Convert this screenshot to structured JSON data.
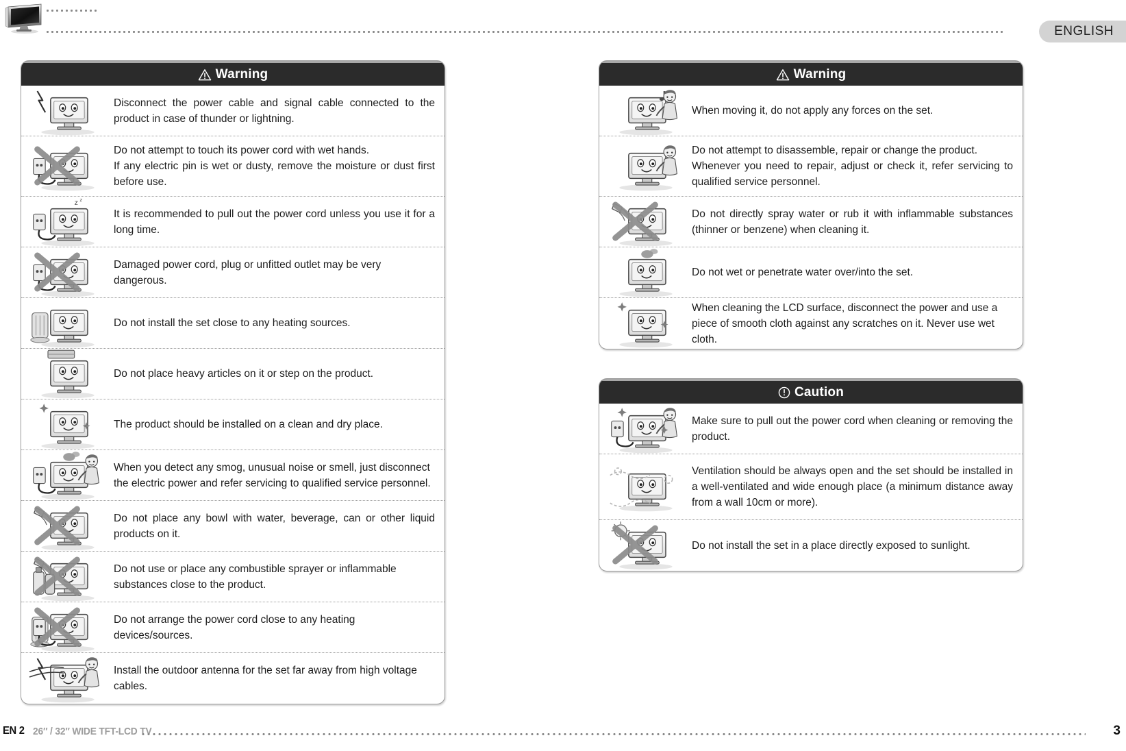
{
  "header": {
    "logo_icon": "tv-icon",
    "language_tab": "ENGLISH"
  },
  "panels": [
    {
      "id": "warning-left",
      "title": "Warning",
      "icon": "warning-triangle-icon",
      "rows": [
        {
          "illustration": "tv-lightning-illustration",
          "text": "Disconnect the power cable and signal cable connected to the product in case of thunder or lightning.",
          "justify": true
        },
        {
          "illustration": "wet-hands-plug-crossed-illustration",
          "text": "Do not attempt to touch its power cord with wet hands.\nIf any electric pin is wet or dusty, remove the moisture or dust first before use.",
          "justify": true
        },
        {
          "illustration": "sleeping-tv-unplug-illustration",
          "text": "It is recommended to pull out the power cord unless you use it for a long time.",
          "justify": true
        },
        {
          "illustration": "damaged-plug-crossed-illustration",
          "text": "Damaged power cord, plug or unfitted outlet may be very dangerous.",
          "justify": false
        },
        {
          "illustration": "heater-near-tv-illustration",
          "text": "Do not install the set close to any heating sources.",
          "justify": false
        },
        {
          "illustration": "heavy-articles-on-tv-illustration",
          "text": "Do not place heavy articles on it or step on the product.",
          "justify": false
        },
        {
          "illustration": "clean-dry-place-illustration",
          "text": "The product should be installed on a clean and dry place.",
          "justify": false
        },
        {
          "illustration": "smoke-smell-unplug-illustration",
          "text": "When you detect any smog, unusual noise or smell, just disconnect the electric power and refer servicing to qualified service personnel.",
          "justify": false
        },
        {
          "illustration": "liquid-on-tv-crossed-illustration",
          "text": "Do not place any bowl with water, beverage, can or other liquid products on it.",
          "justify": true
        },
        {
          "illustration": "combustible-sprayer-crossed-illustration",
          "text": "Do not use or place any combustible sprayer or inflammable substances close to the product.",
          "justify": false
        },
        {
          "illustration": "cord-near-heater-crossed-illustration",
          "text": "Do not arrange the power cord close to any heating devices/sources.",
          "justify": false
        },
        {
          "illustration": "outdoor-antenna-high-voltage-illustration",
          "text": "Install the outdoor antenna for the set far away from high voltage cables.",
          "justify": false
        }
      ]
    },
    {
      "id": "warning-right",
      "title": "Warning",
      "icon": "warning-triangle-icon",
      "rows": [
        {
          "illustration": "moving-tv-carefully-illustration",
          "text": "When moving it, do not apply any forces on the set.",
          "justify": false
        },
        {
          "illustration": "disassemble-repair-illustration",
          "text": "Do not attempt to disassemble, repair or change the product.\nWhenever you need to repair, adjust or check it, refer servicing to qualified service personnel.",
          "justify": true
        },
        {
          "illustration": "spray-inflammable-crossed-illustration",
          "text": "Do not directly spray water or rub it with inflammable substances (thinner or benzene) when cleaning it.",
          "justify": true
        },
        {
          "illustration": "wet-tv-smoke-illustration",
          "text": "Do not wet or penetrate water over/into the set.",
          "justify": false
        },
        {
          "illustration": "clean-lcd-cloth-illustration",
          "text": "When cleaning the LCD surface, disconnect the power and use a piece of smooth cloth against any scratches on it. Never use wet cloth.",
          "justify": false
        }
      ]
    },
    {
      "id": "caution-right",
      "title": "Caution",
      "icon": "caution-circle-icon",
      "rows": [
        {
          "illustration": "pull-cord-cleaning-illustration",
          "text": "Make sure to pull out the power cord when cleaning or removing the product.",
          "justify": true
        },
        {
          "illustration": "ventilation-airflow-illustration",
          "text": "Ventilation should be always open and the set should be installed in a well-ventilated and wide enough place (a minimum distance away from a wall 10cm or more).",
          "justify": true
        },
        {
          "illustration": "direct-sunlight-crossed-illustration",
          "text": "Do not install the set in a place directly exposed to sunlight.",
          "justify": false
        }
      ]
    }
  ],
  "footer": {
    "en_label": "EN 2",
    "model": "26″ / 32″ WIDE TFT-LCD TV",
    "page_number": "3"
  },
  "colors": {
    "header_bar": "#2b2b2b",
    "header_bar_top": "#a8a8a8",
    "panel_border": "#9a9a9a",
    "dots": "#8a8a8a",
    "lang_tab_bg": "#d3d3d3",
    "footer_model_gray": "#9d9d9d"
  }
}
